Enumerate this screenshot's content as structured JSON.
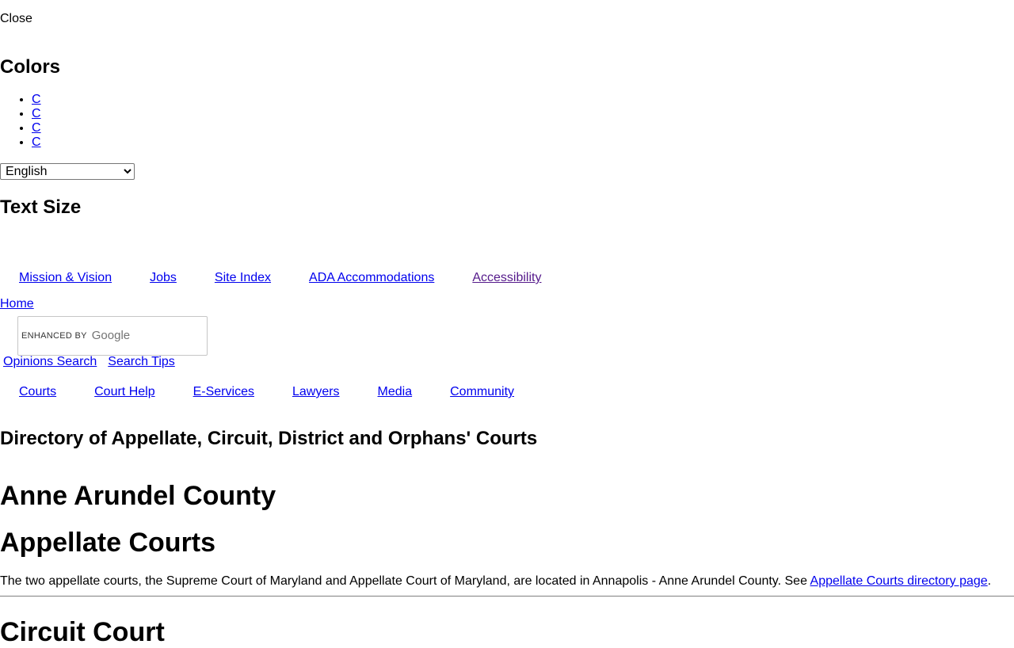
{
  "header": {
    "close_alt": "Close",
    "colors_title": "Colors",
    "color_options": [
      "C",
      "C",
      "C",
      "C"
    ],
    "language": {
      "selected": "English",
      "options": [
        "English"
      ]
    },
    "text_size_title": "Text Size"
  },
  "utility_nav": {
    "items": [
      "Mission & Vision",
      "Jobs",
      "Site Index",
      "ADA Accommodations",
      "Accessibility"
    ]
  },
  "home_alt": "Home",
  "search": {
    "enhanced_by": "ENHANCED BY",
    "brand": "Google",
    "links": [
      "Opinions Search",
      "Search Tips"
    ]
  },
  "main_nav": {
    "items": [
      "Courts",
      "Court Help",
      "E-Services",
      "Lawyers",
      "Media",
      "Community"
    ]
  },
  "content": {
    "directory_title": "Directory of Appellate, Circuit, District and Orphans' Courts",
    "county": "Anne Arundel County",
    "appellate_heading": "Appellate Courts",
    "appellate_text": "The two appellate courts, the Supreme Court of Maryland and Appellate Court of Maryland, are located in Annapolis - Anne Arundel County. See ",
    "appellate_link": "Appellate Courts directory page",
    "appellate_text_end": ".",
    "circuit_heading": "Circuit Court"
  },
  "colors": {
    "link": "#0000ee",
    "visited": "#551a8b"
  }
}
